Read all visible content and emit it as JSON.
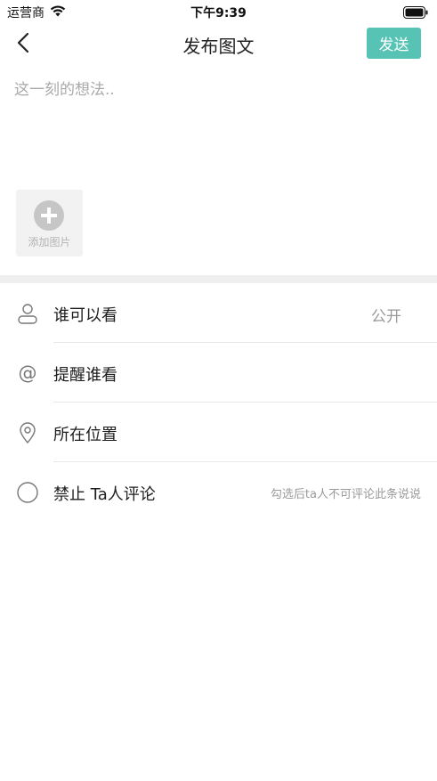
{
  "status_bar": {
    "carrier": "运营商",
    "time": "下午9:39"
  },
  "nav": {
    "title": "发布图文",
    "send_label": "发送"
  },
  "editor": {
    "placeholder": "这一刻的想法.."
  },
  "add_image": {
    "label": "添加图片"
  },
  "options": [
    {
      "label": "谁可以看",
      "value": "公开",
      "icon": "person-icon"
    },
    {
      "label": "提醒谁看",
      "icon": "at-icon"
    },
    {
      "label": "所在位置",
      "icon": "location-pin-icon"
    },
    {
      "label": "禁止 Ta人评论",
      "hint": "勾选后ta人不可评论此条说说",
      "icon": "radio-circle-icon"
    }
  ],
  "colors": {
    "accent": "#57c3b5",
    "divider": "#efefef",
    "muted_text": "#9a9a9a"
  }
}
